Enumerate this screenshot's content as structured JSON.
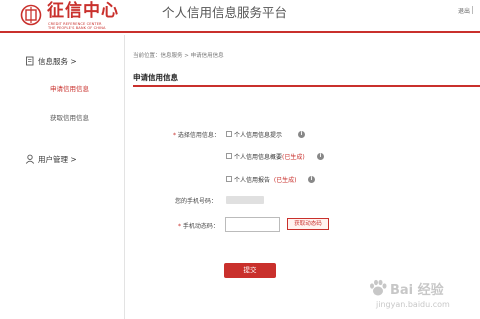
{
  "header": {
    "logo_text": "征信中心",
    "logo_en_line1": "CREDIT REFERENCE CENTER",
    "logo_en_line2": "THE PEOPLE'S BANK OF CHINA",
    "site_title": "个人信用信息服务平台",
    "logout_label": "退出"
  },
  "sidebar": {
    "groups": [
      {
        "label": "信息服务 >",
        "icon": "document-icon",
        "items": [
          {
            "label": "申请信用信息",
            "active": true
          },
          {
            "label": "获取信用信息",
            "active": false
          }
        ]
      },
      {
        "label": "用户管理 >",
        "icon": "user-icon",
        "items": []
      }
    ]
  },
  "main": {
    "breadcrumb": "当前位置：信息服务 > 申请信用信息",
    "section_title": "申请信用信息",
    "form": {
      "select_label": "选择信用信息：",
      "required_mark": "*",
      "options": [
        {
          "label": "个人信用信息提示",
          "note": ""
        },
        {
          "label": "个人信用信息概要",
          "note": "(已生成)"
        },
        {
          "label": "个人信用报告",
          "note": "(已生成)"
        }
      ],
      "phone_label": "您的手机号码：",
      "code_label": "手机动态码：",
      "code_placeholder": "",
      "get_code_label": "获取动态码",
      "submit_label": "提交"
    }
  },
  "watermark": {
    "text": "Bai 经验",
    "url": "jingyan.baidu.com"
  },
  "colors": {
    "accent": "#c9302c",
    "text": "#333333",
    "muted": "#777777"
  }
}
